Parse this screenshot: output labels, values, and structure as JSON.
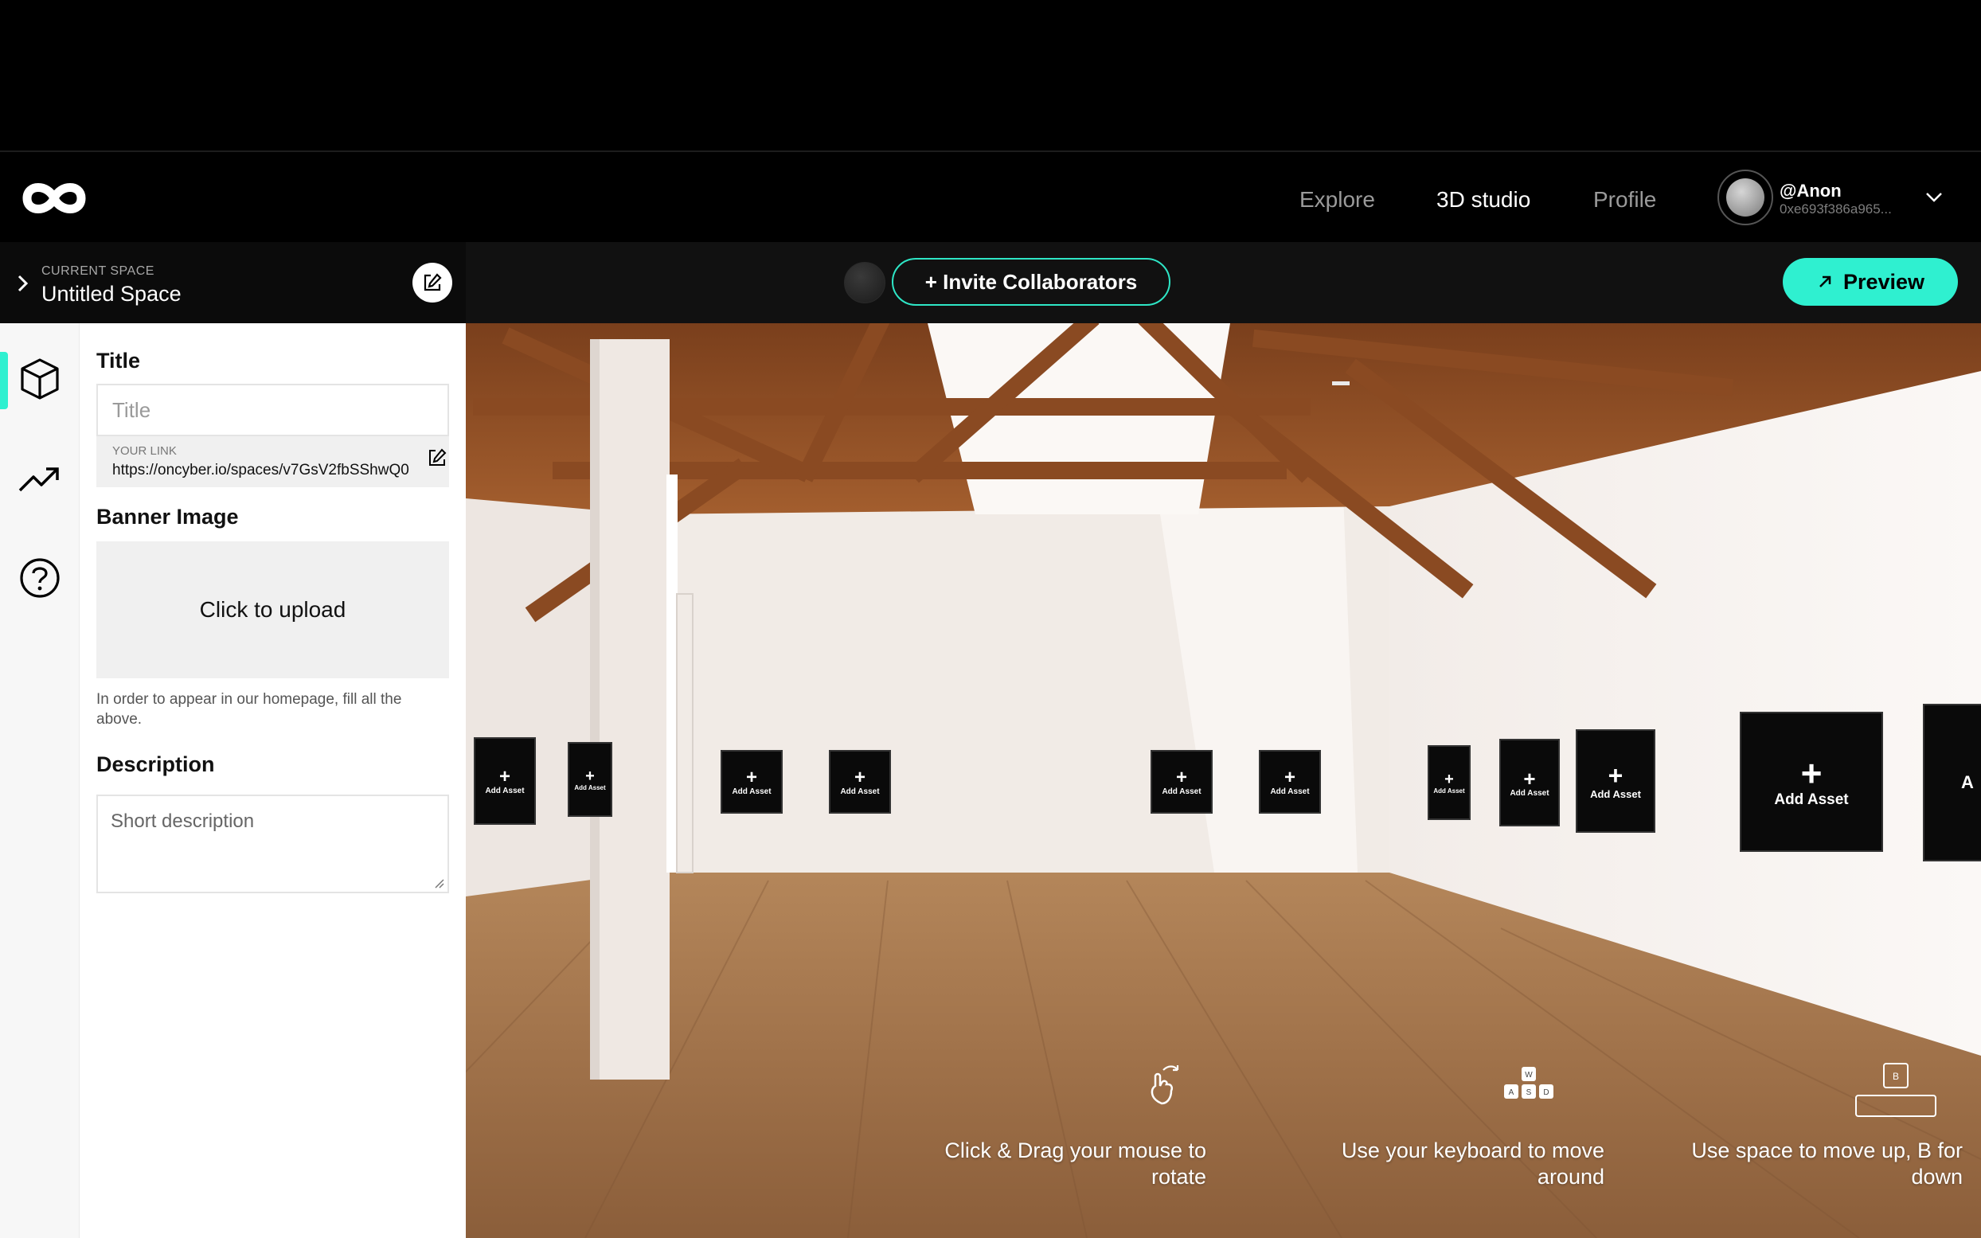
{
  "nav": {
    "links": [
      "Explore",
      "3D studio",
      "Profile"
    ],
    "active_link": "3D studio",
    "user": {
      "name": "@Anon",
      "address": "0xe693f386a965..."
    }
  },
  "space": {
    "label": "CURRENT SPACE",
    "name": "Untitled Space"
  },
  "toolbar": {
    "invite_label": "+ Invite Collaborators",
    "preview_label": "Preview"
  },
  "panel": {
    "title_heading": "Title",
    "title_placeholder": "Title",
    "link_label": "YOUR LINK",
    "link_url": "https://oncyber.io/spaces/v7GsV2fbSShwQ0",
    "banner_heading": "Banner Image",
    "upload_label": "Click to upload",
    "hint": "In order to appear in our homepage, fill all the above.",
    "description_heading": "Description",
    "description_placeholder": "Short description"
  },
  "scene": {
    "asset_label": "Add Asset",
    "asset_label_cut": "A",
    "hints": [
      "Click & Drag your mouse to rotate",
      "Use your keyboard to move around",
      "Use space to move up, B for down"
    ],
    "keys": [
      "W",
      "A",
      "S",
      "D",
      "B"
    ]
  },
  "colors": {
    "accent": "#2ff0d0",
    "background": "#000000",
    "panel": "#ffffff"
  }
}
